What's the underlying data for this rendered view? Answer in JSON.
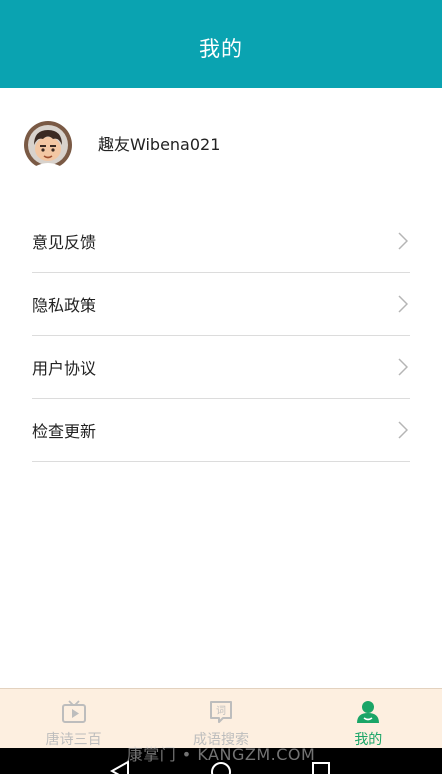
{
  "header": {
    "title": "我的"
  },
  "profile": {
    "username": "趣友Wibena021"
  },
  "menu": {
    "items": [
      {
        "label": "意见反馈",
        "icon": "chevron-right-icon"
      },
      {
        "label": "隐私政策",
        "icon": "chevron-right-icon"
      },
      {
        "label": "用户协议",
        "icon": "chevron-right-icon"
      },
      {
        "label": "检查更新",
        "icon": "chevron-right-icon"
      }
    ]
  },
  "tabbar": {
    "tabs": [
      {
        "label": "唐诗三百",
        "icon": "tv-play-icon",
        "active": false
      },
      {
        "label": "成语搜索",
        "icon": "dictionary-icon",
        "icon_text": "词",
        "active": false
      },
      {
        "label": "我的",
        "icon": "user-icon",
        "active": true
      }
    ]
  },
  "watermark": {
    "text": "康掌门 • KANGZM.COM"
  },
  "colors": {
    "header_bg": "#0aa3b1",
    "tabbar_bg": "#fdefe0",
    "tab_active": "#1aa567",
    "tab_inactive": "#bdbdbd"
  }
}
